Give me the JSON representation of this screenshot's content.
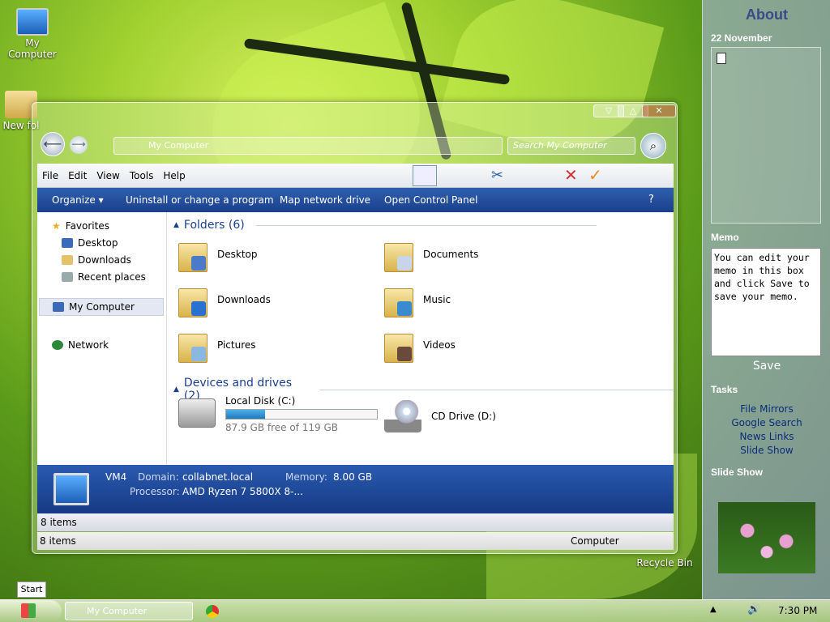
{
  "desktop": {
    "icons": [
      {
        "label": "My Computer"
      },
      {
        "label": "New fol"
      },
      {
        "label": "Recycle Bin"
      }
    ]
  },
  "sidebar": {
    "title": "About",
    "date": "22 November",
    "memo": {
      "title": "Memo",
      "text": "You can edit your memo in this box and click Save to save your memo.",
      "save": "Save"
    },
    "tasks": {
      "title": "Tasks",
      "items": [
        "File Mirrors",
        "Google Search",
        "News Links",
        "Slide Show"
      ]
    },
    "slideshow": {
      "title": "Slide Show"
    }
  },
  "window": {
    "address": "My Computer",
    "search_placeholder": "Search My Computer",
    "menu": [
      "File",
      "Edit",
      "View",
      "Tools",
      "Help"
    ],
    "commands": [
      "Organize",
      "Uninstall or change a program",
      "Map network drive",
      "Open Control Panel"
    ],
    "nav": {
      "favorites": "Favorites",
      "fav_items": [
        "Desktop",
        "Downloads",
        "Recent places"
      ],
      "computer": "My Computer",
      "network": "Network"
    },
    "folders_header": "Folders (6)",
    "folders": [
      {
        "name": "Desktop"
      },
      {
        "name": "Documents"
      },
      {
        "name": "Downloads"
      },
      {
        "name": "Music"
      },
      {
        "name": "Pictures"
      },
      {
        "name": "Videos"
      }
    ],
    "drives_header": "Devices and drives (2)",
    "drives": [
      {
        "name": "Local Disk (C:)",
        "free": "87.9 GB free of 119 GB",
        "used_fraction": 0.26
      },
      {
        "name": "CD Drive (D:)"
      }
    ],
    "details": {
      "name": "VM4",
      "domain_label": "Domain:",
      "domain": "collabnet.local",
      "memory_label": "Memory:",
      "memory": "8.00 GB",
      "processor_label": "Processor:",
      "processor": "AMD Ryzen 7 5800X 8-..."
    },
    "status_items": "8 items",
    "status_items2": "8 items",
    "status_location": "Computer"
  },
  "taskbar": {
    "start_tooltip": "Start",
    "task": "My Computer",
    "time": "7:30 PM"
  }
}
